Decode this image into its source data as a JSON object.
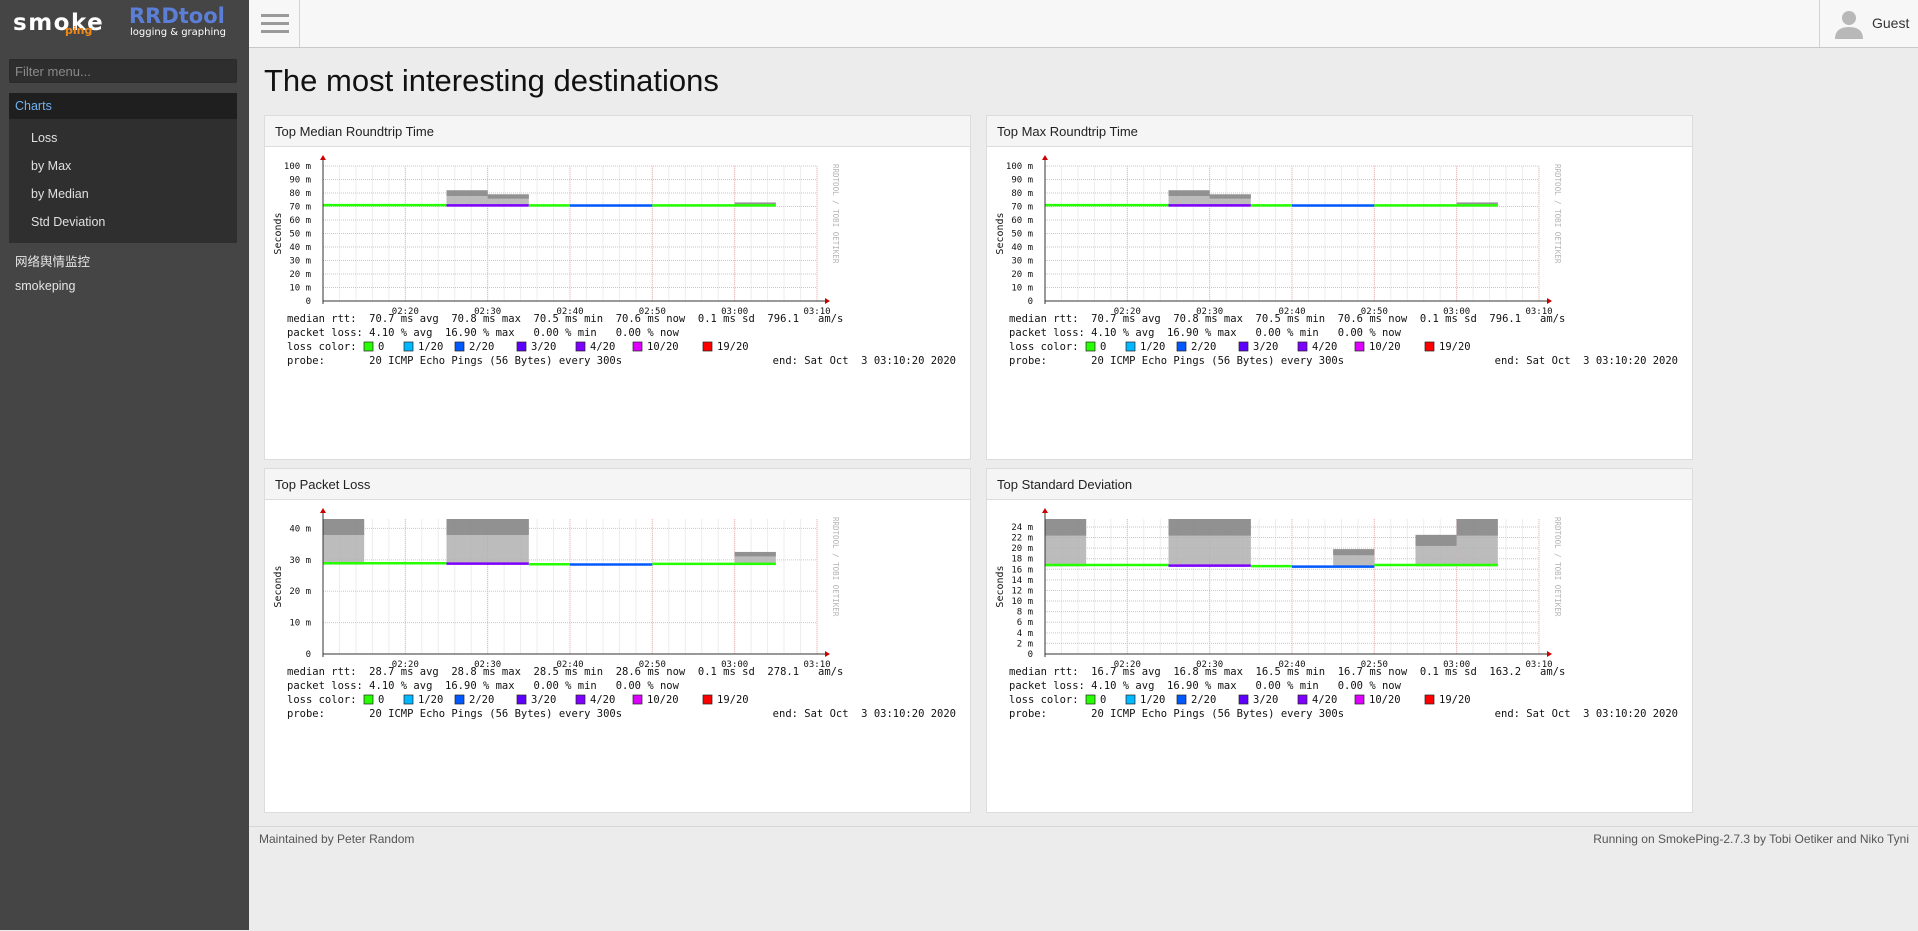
{
  "brand": {
    "smoke": "smoke",
    "ping": "ping",
    "rrd": "RRDtool",
    "rrd_sub": "logging & graphing"
  },
  "sidebar": {
    "filter_placeholder": "Filter menu...",
    "group_label": "Charts",
    "items": [
      "Loss",
      "by Max",
      "by Median",
      "Std Deviation"
    ],
    "top_items": [
      "网络舆情监控",
      "smokeping"
    ]
  },
  "topbar": {
    "user_label": "Guest"
  },
  "page": {
    "title": "The most interesting destinations"
  },
  "footer": {
    "left": "Maintained by Peter Random",
    "right": "Running on SmokePing-2.7.3 by Tobi Oetiker and Niko Tyni"
  },
  "colors": {
    "accent": "#6fb3f0",
    "sidebar": "#454545",
    "median_green": "#00e000",
    "median_blue": "#0055ff",
    "median_purple": "#6a00d9"
  },
  "legend_common": {
    "loss_color_label": "loss color:",
    "loss_keys": [
      {
        "label": "0",
        "color": "#26ff00"
      },
      {
        "label": "1/20",
        "color": "#00b8ff"
      },
      {
        "label": "2/20",
        "color": "#0059ff"
      },
      {
        "label": "3/20",
        "color": "#5e00ff"
      },
      {
        "label": "4/20",
        "color": "#7e00ff"
      },
      {
        "label": "10/20",
        "color": "#dd00ff"
      },
      {
        "label": "19/20",
        "color": "#ff0000"
      }
    ],
    "probe": "probe:       20 ICMP Echo Pings (56 Bytes) every 300s",
    "end": "end: Sat Oct  3 03:10:20 2020",
    "watermark": "RRDTOOL / TOBI OETIKER"
  },
  "chart_data": [
    {
      "type": "area",
      "title": "Top Median Roundtrip Time",
      "ylabel": "Seconds",
      "x_ticks": [
        "02:20",
        "02:30",
        "02:40",
        "02:50",
        "03:00",
        "03:10"
      ],
      "y_ticks": [
        "0",
        "10 m",
        "20 m",
        "30 m",
        "40 m",
        "50 m",
        "60 m",
        "70 m",
        "80 m",
        "90 m",
        "100 m"
      ],
      "ylim": [
        0,
        100
      ],
      "median_segments": [
        {
          "from": "02:10",
          "to": "02:25",
          "value": 71,
          "loss": "0"
        },
        {
          "from": "02:25",
          "to": "02:35",
          "value": 70.8,
          "loss": "4/20"
        },
        {
          "from": "02:35",
          "to": "02:40",
          "value": 70.8,
          "loss": "0"
        },
        {
          "from": "02:40",
          "to": "02:50",
          "value": 70.7,
          "loss": "2/20"
        },
        {
          "from": "02:50",
          "to": "03:05",
          "value": 70.8,
          "loss": "0"
        }
      ],
      "smoke_max": [
        {
          "from": "02:25",
          "to": "02:30",
          "value": 82
        },
        {
          "from": "02:30",
          "to": "02:35",
          "value": 79
        },
        {
          "from": "03:00",
          "to": "03:05",
          "value": 73
        }
      ],
      "stats": {
        "median": "median rtt:  70.7 ms avg  70.8 ms max  70.5 ms min  70.6 ms now  0.1 ms sd  796.1   am/s",
        "loss": "packet loss: 4.10 % avg  16.90 % max   0.00 % min   0.00 % now"
      }
    },
    {
      "type": "area",
      "title": "Top Max Roundtrip Time",
      "ylabel": "Seconds",
      "x_ticks": [
        "02:20",
        "02:30",
        "02:40",
        "02:50",
        "03:00",
        "03:10"
      ],
      "y_ticks": [
        "0",
        "10 m",
        "20 m",
        "30 m",
        "40 m",
        "50 m",
        "60 m",
        "70 m",
        "80 m",
        "90 m",
        "100 m"
      ],
      "ylim": [
        0,
        100
      ],
      "median_segments": [
        {
          "from": "02:10",
          "to": "02:25",
          "value": 71,
          "loss": "0"
        },
        {
          "from": "02:25",
          "to": "02:35",
          "value": 70.8,
          "loss": "4/20"
        },
        {
          "from": "02:35",
          "to": "02:40",
          "value": 70.8,
          "loss": "0"
        },
        {
          "from": "02:40",
          "to": "02:50",
          "value": 70.7,
          "loss": "2/20"
        },
        {
          "from": "02:50",
          "to": "03:05",
          "value": 70.8,
          "loss": "0"
        }
      ],
      "smoke_max": [
        {
          "from": "02:25",
          "to": "02:30",
          "value": 82
        },
        {
          "from": "02:30",
          "to": "02:35",
          "value": 79
        },
        {
          "from": "03:00",
          "to": "03:05",
          "value": 73
        }
      ],
      "stats": {
        "median": "median rtt:  70.7 ms avg  70.8 ms max  70.5 ms min  70.6 ms now  0.1 ms sd  796.1   am/s",
        "loss": "packet loss: 4.10 % avg  16.90 % max   0.00 % min   0.00 % now"
      }
    },
    {
      "type": "area",
      "title": "Top Packet Loss",
      "ylabel": "Seconds",
      "x_ticks": [
        "02:20",
        "02:30",
        "02:40",
        "02:50",
        "03:00",
        "03:10"
      ],
      "y_ticks": [
        "0",
        "10 m",
        "20 m",
        "30 m",
        "40 m"
      ],
      "ylim": [
        0,
        43
      ],
      "median_segments": [
        {
          "from": "02:10",
          "to": "02:25",
          "value": 28.9,
          "loss": "0"
        },
        {
          "from": "02:25",
          "to": "02:35",
          "value": 28.8,
          "loss": "4/20"
        },
        {
          "from": "02:35",
          "to": "02:40",
          "value": 28.6,
          "loss": "0"
        },
        {
          "from": "02:40",
          "to": "02:50",
          "value": 28.5,
          "loss": "2/20"
        },
        {
          "from": "02:50",
          "to": "03:05",
          "value": 28.7,
          "loss": "0"
        }
      ],
      "smoke_max": [
        {
          "from": "02:10",
          "to": "02:15",
          "value": 43
        },
        {
          "from": "02:25",
          "to": "02:35",
          "value": 43
        },
        {
          "from": "03:00",
          "to": "03:05",
          "value": 32.5
        }
      ],
      "stats": {
        "median": "median rtt:  28.7 ms avg  28.8 ms max  28.5 ms min  28.6 ms now  0.1 ms sd  278.1   am/s",
        "loss": "packet loss: 4.10 % avg  16.90 % max   0.00 % min   0.00 % now"
      }
    },
    {
      "type": "area",
      "title": "Top Standard Deviation",
      "ylabel": "Seconds",
      "x_ticks": [
        "02:20",
        "02:30",
        "02:40",
        "02:50",
        "03:00",
        "03:10"
      ],
      "y_ticks": [
        "0",
        "2 m",
        "4 m",
        "6 m",
        "8 m",
        "10 m",
        "12 m",
        "14 m",
        "16 m",
        "18 m",
        "20 m",
        "22 m",
        "24 m"
      ],
      "ylim": [
        0,
        25.5
      ],
      "median_segments": [
        {
          "from": "02:10",
          "to": "02:25",
          "value": 16.8,
          "loss": "0"
        },
        {
          "from": "02:25",
          "to": "02:35",
          "value": 16.7,
          "loss": "4/20"
        },
        {
          "from": "02:35",
          "to": "02:40",
          "value": 16.6,
          "loss": "0"
        },
        {
          "from": "02:40",
          "to": "02:50",
          "value": 16.5,
          "loss": "2/20"
        },
        {
          "from": "02:50",
          "to": "03:05",
          "value": 16.8,
          "loss": "0"
        }
      ],
      "smoke_max": [
        {
          "from": "02:10",
          "to": "02:15",
          "value": 25.5
        },
        {
          "from": "02:25",
          "to": "02:35",
          "value": 25.5
        },
        {
          "from": "02:45",
          "to": "02:50",
          "value": 19.8
        },
        {
          "from": "02:55",
          "to": "03:00",
          "value": 22.5
        },
        {
          "from": "03:00",
          "to": "03:05",
          "value": 25.5
        }
      ],
      "stats": {
        "median": "median rtt:  16.7 ms avg  16.8 ms max  16.5 ms min  16.7 ms now  0.1 ms sd  163.2   am/s",
        "loss": "packet loss: 4.10 % avg  16.90 % max   0.00 % min   0.00 % now"
      }
    }
  ]
}
